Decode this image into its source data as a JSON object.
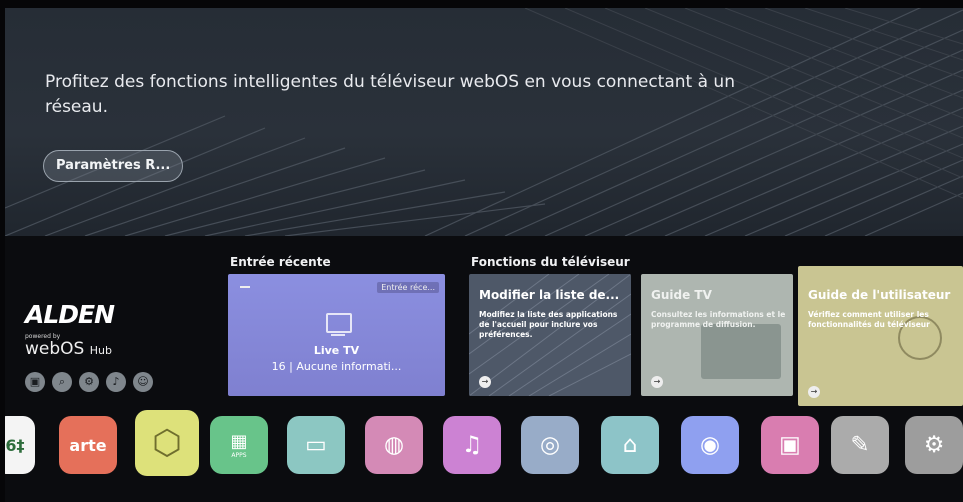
{
  "hero": {
    "message": "Profitez des fonctions intelligentes du téléviseur webOS en vous connectant à un réseau.",
    "button_label": "Paramètres R..."
  },
  "brand": {
    "logo_text": "ALDEN",
    "powered_by": "powered by",
    "platform": "webOS",
    "platform_suffix": "Hub"
  },
  "quick_icons": [
    "input-icon",
    "search-icon",
    "settings-icon",
    "notification-icon",
    "profile-icon"
  ],
  "recent": {
    "section_title": "Entrée récente",
    "tag": "Entrée réce...",
    "name": "Live TV",
    "subtitle": "16 | Aucune informati..."
  },
  "features": {
    "section_title": "Fonctions du téléviseur",
    "cards": [
      {
        "title": "Modifier la liste de...",
        "description": "Modifiez la liste des applications de l'accueil pour inclure vos préférences."
      },
      {
        "title": "Guide TV",
        "description": "Consultez les informations et le programme de diffusion."
      },
      {
        "title": "Guide de l'utilisateur",
        "description": "Vérifiez comment utiliser les fonctionnalités du téléviseur"
      }
    ]
  },
  "apps": [
    {
      "name": "channel-app",
      "label": "6‡",
      "color": "#ffffff"
    },
    {
      "name": "arte-app",
      "label": "arte",
      "color": "#e5705a"
    },
    {
      "name": "yellow-app",
      "label": "",
      "color": "#dde17a"
    },
    {
      "name": "apps-app",
      "label": "APPS",
      "color": "#68c48a"
    },
    {
      "name": "screen-share-app",
      "label": "",
      "color": "#8cc7c2"
    },
    {
      "name": "game-app",
      "label": "",
      "color": "#d48ab6"
    },
    {
      "name": "music-app",
      "label": "",
      "color": "#cc82d3"
    },
    {
      "name": "sync-app",
      "label": "",
      "color": "#98acc8"
    },
    {
      "name": "education-app",
      "label": "",
      "color": "#8dc4c8"
    },
    {
      "name": "browser-app",
      "label": "",
      "color": "#8fa0f0"
    },
    {
      "name": "gallery-app",
      "label": "",
      "color": "#d97db0"
    },
    {
      "name": "edit-app",
      "label": "",
      "color": "#ababab"
    },
    {
      "name": "settings-app",
      "label": "",
      "color": "#9d9d9d"
    }
  ]
}
